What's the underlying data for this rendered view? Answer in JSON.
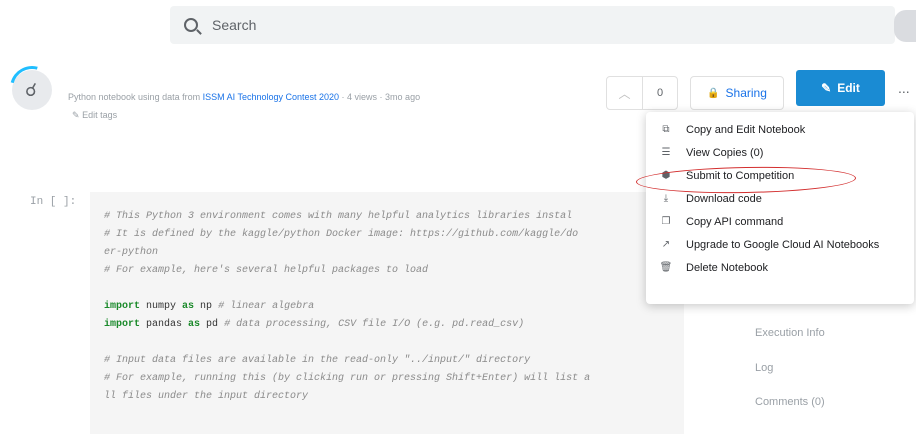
{
  "search": {
    "placeholder": "Search"
  },
  "notebook": {
    "meta_prefix": "Python notebook using data from",
    "dataset_link": "ISSM AI Technology Contest 2020",
    "meta_suffix": "· 4 views · 3mo ago",
    "edit_tags": "Edit tags"
  },
  "actions": {
    "vote_count": "0",
    "sharing_label": "Sharing",
    "edit_label": "Edit",
    "more_label": "..."
  },
  "menu": {
    "items": [
      {
        "label": "Copy and Edit Notebook",
        "icon": "copy-icon"
      },
      {
        "label": "View Copies (0)",
        "icon": "list-icon"
      },
      {
        "label": "Submit to Competition",
        "icon": "submit-icon"
      },
      {
        "label": "Download code",
        "icon": "download-icon"
      },
      {
        "label": "Copy API command",
        "icon": "copy-api-icon"
      },
      {
        "label": "Upgrade to Google Cloud AI Notebooks",
        "icon": "external-link-icon"
      },
      {
        "label": "Delete Notebook",
        "icon": "trash-icon"
      }
    ]
  },
  "cell": {
    "prompt": "In [ ]:",
    "lines": {
      "l1": "# This Python 3 environment comes with many helpful analytics libraries instal",
      "l2": "# It is defined by the kaggle/python Docker image: https://github.com/kaggle/do",
      "l3": "er-python",
      "l4": "# For example, here's several helpful packages to load",
      "l6_kw1": "import",
      "l6_mid": " numpy ",
      "l6_kw2": "as",
      "l6_rest": " np ",
      "l6_cmt": "# linear algebra",
      "l7_kw1": "import",
      "l7_mid": " pandas ",
      "l7_kw2": "as",
      "l7_rest": " pd ",
      "l7_cmt": "# data processing, CSV file I/O (e.g. pd.read_csv)",
      "l9": "# Input data files are available in the read-only \"../input/\" directory",
      "l10": "# For example, running this (by clicking run or pressing Shift+Enter) will list a",
      "l11": "ll files under the input directory"
    }
  },
  "sidebar": {
    "items": [
      "Execution Info",
      "Log",
      "Comments (0)"
    ]
  },
  "colors": {
    "accent": "#1a8bd3",
    "annotation": "#d32f2f",
    "link": "#1a73e8"
  }
}
